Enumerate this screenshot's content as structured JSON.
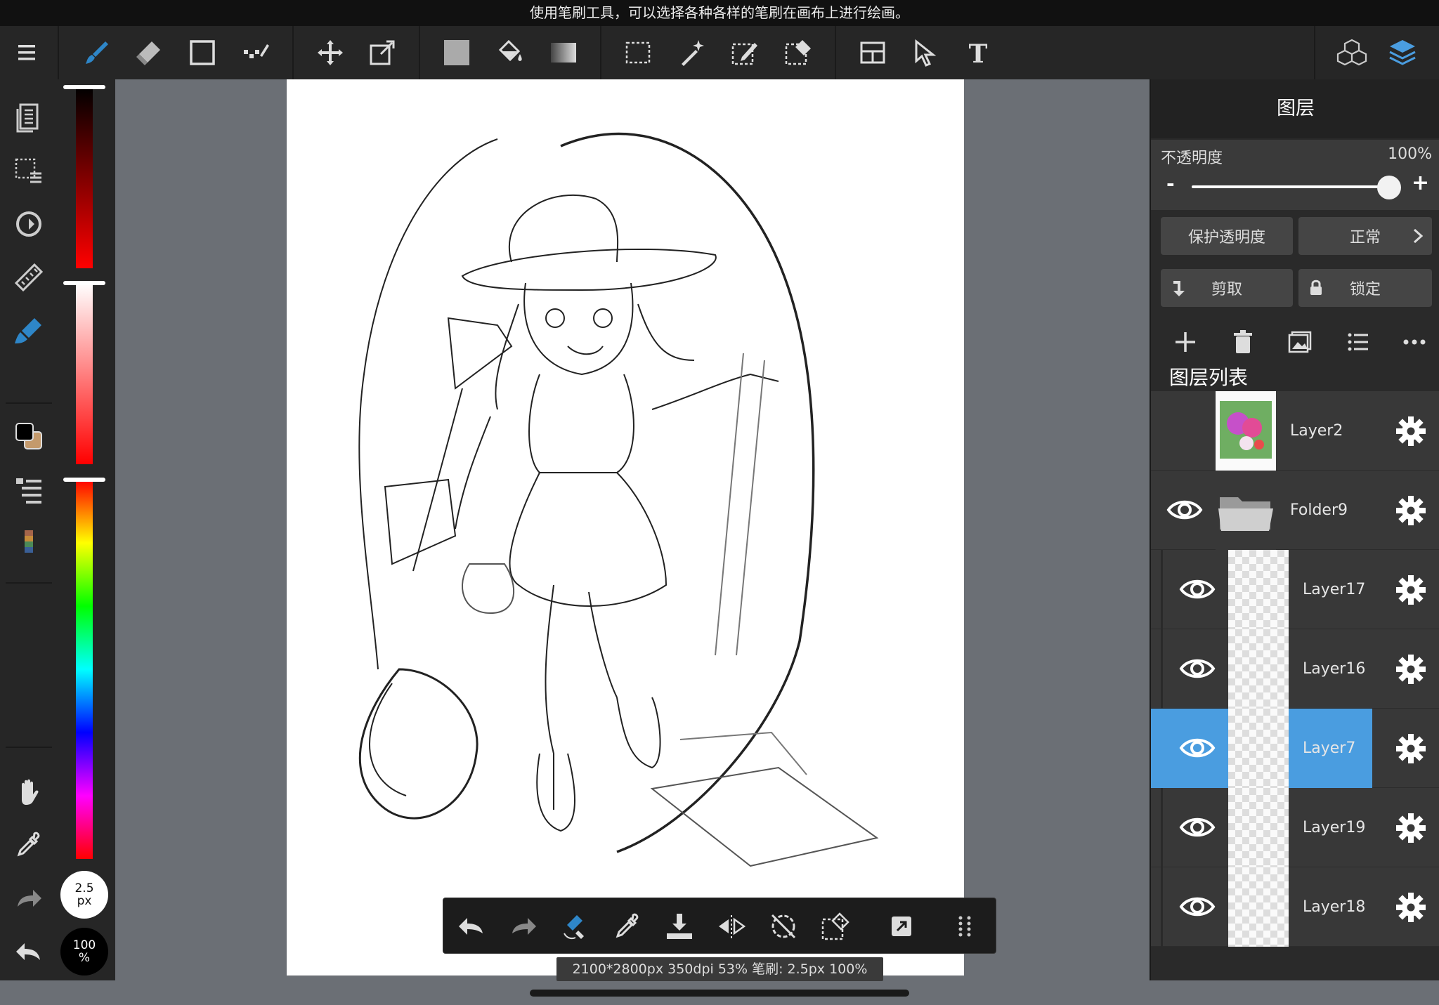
{
  "tip": "使用笔刷工具，可以选择各种各样的笔刷在画布上进行绘画。",
  "toolbar": {
    "tools": [
      "menu-icon",
      "brush-icon",
      "eraser-icon",
      "rectangle-icon",
      "dot-brush-icon",
      "move-icon",
      "transform-icon",
      "fill-color-icon",
      "bucket-icon",
      "gradient-icon",
      "select-rect-icon",
      "magic-wand-icon",
      "select-pen-icon",
      "select-eraser-icon",
      "panel-icon",
      "select-move-icon",
      "text-icon",
      "3d-cube-icon",
      "layers-icon"
    ]
  },
  "colors": {
    "accent": "#4a9de0",
    "brush_blue": "#2e86c8"
  },
  "brush": {
    "size_top": "2.5",
    "size_unit": "px",
    "opacity": "100",
    "opacity_unit": "%"
  },
  "status": "2100*2800px 350dpi 53% 笔刷: 2.5px 100%",
  "panel": {
    "title": "图层",
    "opacity_label": "不透明度",
    "opacity_value": "100%",
    "minus": "-",
    "plus": "+",
    "protect_alpha": "保护透明度",
    "blend_mode": "正常",
    "clip": "剪取",
    "lock": "锁定",
    "list_title": "图层列表",
    "layers": [
      {
        "name": "Layer2",
        "visible": false,
        "selected": false,
        "type": "image"
      },
      {
        "name": "Folder9",
        "visible": true,
        "selected": false,
        "type": "folder"
      },
      {
        "name": "Layer17",
        "visible": true,
        "selected": false,
        "type": "layer"
      },
      {
        "name": "Layer16",
        "visible": true,
        "selected": false,
        "type": "layer"
      },
      {
        "name": "Layer7",
        "visible": true,
        "selected": true,
        "type": "layer"
      },
      {
        "name": "Layer19",
        "visible": true,
        "selected": false,
        "type": "layer"
      },
      {
        "name": "Layer18",
        "visible": true,
        "selected": false,
        "type": "layer"
      }
    ]
  }
}
